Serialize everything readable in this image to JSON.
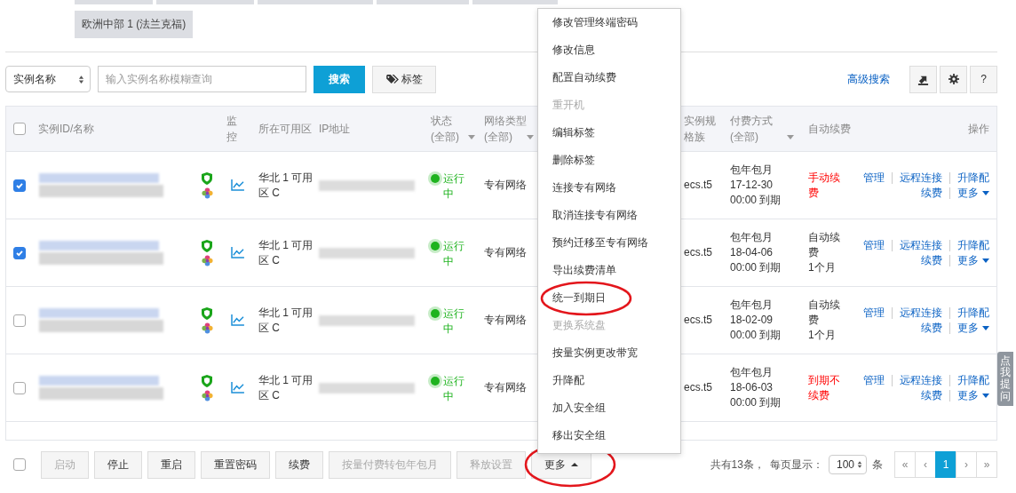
{
  "region_tabs": [
    {
      "label": "欧洲中部 1 (法兰克福)",
      "selected": false
    }
  ],
  "toolbar": {
    "filter_select": "实例名称",
    "search": {
      "placeholder": "输入实例名称模糊查询"
    },
    "search_button": "搜索",
    "tag_button": "标签",
    "advanced_search": "高级搜索",
    "help_button": "?"
  },
  "table": {
    "select_all": {
      "checked": false
    },
    "columns": [
      {
        "label": "实例ID/名称",
        "filter": false
      },
      {
        "label": "监控",
        "filter": false
      },
      {
        "label": "所在可用区",
        "filter": false
      },
      {
        "label": "IP地址",
        "filter": false
      },
      {
        "label": "状态(全部)",
        "filter": true
      },
      {
        "label": "网络类型(全部)",
        "filter": true
      },
      {
        "label": "实例规格族",
        "filter": false
      },
      {
        "label": "付费方式(全部)",
        "filter": true
      },
      {
        "label": "自动续费",
        "filter": false
      },
      {
        "label": "操作",
        "filter": false
      }
    ],
    "rows": [
      {
        "checked": true,
        "zone": "华北 1 可用区 C",
        "status": {
          "kind": "running",
          "label": "运行中"
        },
        "network": "专有网络",
        "spec": "ecs.t5",
        "pay_type": "包年包月",
        "expiry_date": "17-12-30",
        "expiry_time": "00:00 到期",
        "renew": {
          "kind": "manual",
          "label": "手动续费"
        },
        "actions": [
          {
            "label": "管理",
            "kind": "link"
          },
          {
            "label": "远程连接",
            "kind": "link"
          },
          {
            "label": "升降配",
            "kind": "link"
          },
          {
            "label": "续费",
            "kind": "link"
          },
          {
            "label": "更多",
            "kind": "dropdown"
          }
        ]
      },
      {
        "checked": true,
        "zone": "华北 1 可用区 C",
        "status": {
          "kind": "running",
          "label": "运行中"
        },
        "network": "专有网络",
        "spec": "ecs.t5",
        "pay_type": "包年包月",
        "expiry_date": "18-04-06",
        "expiry_time": "00:00 到期",
        "renew": {
          "kind": "auto",
          "label": "自动续费",
          "period": "1个月"
        },
        "actions": [
          {
            "label": "管理",
            "kind": "link"
          },
          {
            "label": "远程连接",
            "kind": "link"
          },
          {
            "label": "升降配",
            "kind": "link"
          },
          {
            "label": "续费",
            "kind": "link"
          },
          {
            "label": "更多",
            "kind": "dropdown"
          }
        ]
      },
      {
        "checked": false,
        "zone": "华北 1 可用区 C",
        "status": {
          "kind": "running",
          "label": "运行中"
        },
        "network": "专有网络",
        "spec": "ecs.t5",
        "pay_type": "包年包月",
        "expiry_date": "18-02-09",
        "expiry_time": "00:00 到期",
        "renew": {
          "kind": "auto",
          "label": "自动续费",
          "period": "1个月"
        },
        "actions": [
          {
            "label": "管理",
            "kind": "link"
          },
          {
            "label": "远程连接",
            "kind": "link"
          },
          {
            "label": "升降配",
            "kind": "link"
          },
          {
            "label": "续费",
            "kind": "link"
          },
          {
            "label": "更多",
            "kind": "dropdown"
          }
        ]
      },
      {
        "checked": false,
        "zone": "华北 1 可用区 C",
        "status": {
          "kind": "running",
          "label": "运行中"
        },
        "network": "专有网络",
        "spec": "ecs.t5",
        "pay_type": "包年包月",
        "expiry_date": "18-06-03",
        "expiry_time": "00:00 到期",
        "renew": {
          "kind": "none",
          "label": "到期不续费"
        },
        "actions": [
          {
            "label": "管理",
            "kind": "link"
          },
          {
            "label": "远程连接",
            "kind": "link"
          },
          {
            "label": "升降配",
            "kind": "link"
          },
          {
            "label": "续费",
            "kind": "link"
          },
          {
            "label": "更多",
            "kind": "dropdown"
          }
        ]
      }
    ]
  },
  "more_menu": {
    "items": [
      {
        "label": "修改管理终端密码",
        "disabled": false,
        "circled": false
      },
      {
        "label": "修改信息",
        "disabled": false,
        "circled": false
      },
      {
        "label": "配置自动续费",
        "disabled": false,
        "circled": false
      },
      {
        "label": "重开机",
        "disabled": true,
        "circled": false
      },
      {
        "label": "编辑标签",
        "disabled": false,
        "circled": false
      },
      {
        "label": "删除标签",
        "disabled": false,
        "circled": false
      },
      {
        "label": "连接专有网络",
        "disabled": false,
        "circled": false
      },
      {
        "label": "取消连接专有网络",
        "disabled": false,
        "circled": false
      },
      {
        "label": "预约迁移至专有网络",
        "disabled": false,
        "circled": false
      },
      {
        "label": "导出续费清单",
        "disabled": false,
        "circled": false
      },
      {
        "label": "统一到期日",
        "disabled": false,
        "circled": true
      },
      {
        "label": "更换系统盘",
        "disabled": true,
        "circled": false
      },
      {
        "label": "按量实例更改带宽",
        "disabled": false,
        "circled": false
      },
      {
        "label": "升降配",
        "disabled": false,
        "circled": false
      },
      {
        "label": "加入安全组",
        "disabled": false,
        "circled": false
      },
      {
        "label": "移出安全组",
        "disabled": false,
        "circled": false
      }
    ]
  },
  "footer": {
    "select_all": {
      "checked": false
    },
    "buttons": [
      {
        "label": "启动",
        "disabled": true,
        "kind": "plain",
        "circled": false
      },
      {
        "label": "停止",
        "disabled": false,
        "kind": "plain",
        "circled": false
      },
      {
        "label": "重启",
        "disabled": false,
        "kind": "plain",
        "circled": false
      },
      {
        "label": "重置密码",
        "disabled": false,
        "kind": "plain",
        "circled": false
      },
      {
        "label": "续费",
        "disabled": false,
        "kind": "plain",
        "circled": false
      },
      {
        "label": "按量付费转包年包月",
        "disabled": true,
        "kind": "plain",
        "circled": false
      },
      {
        "label": "释放设置",
        "disabled": true,
        "kind": "plain",
        "circled": false
      },
      {
        "label": "更多",
        "disabled": false,
        "kind": "dropup",
        "circled": true
      }
    ],
    "total": "共有13条，",
    "page_size_label": "每页显示：",
    "page_size": "100",
    "page_size_unit": "条",
    "pages": [
      {
        "label": "«",
        "selected": false
      },
      {
        "label": "‹",
        "selected": false
      },
      {
        "label": "1",
        "selected": true
      },
      {
        "label": "›",
        "selected": false
      },
      {
        "label": "»",
        "selected": false
      }
    ]
  },
  "help_tab": "点我提问"
}
